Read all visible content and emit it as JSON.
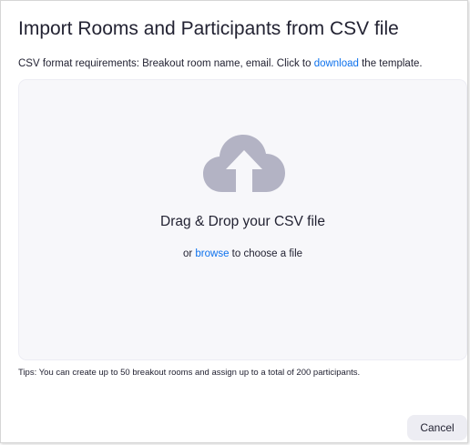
{
  "dialog": {
    "title": "Import Rooms and Participants from CSV file",
    "requirements_prefix": "CSV format requirements: Breakout room name, email. Click to ",
    "download_link": "download",
    "requirements_suffix": " the template.",
    "dropzone": {
      "icon": "cloud-upload-icon",
      "title": "Drag & Drop your CSV file",
      "browse_prefix": "or ",
      "browse_link": "browse",
      "browse_suffix": " to choose a file"
    },
    "tips": "Tips: You can create up to 50 breakout rooms and assign up to a total of 200 participants.",
    "cancel_label": "Cancel"
  },
  "colors": {
    "link": "#0e72ed",
    "text": "#232333",
    "dropzone_bg": "#f7f7fa",
    "icon": "#b3b3c4",
    "button_bg": "#ededf3"
  }
}
